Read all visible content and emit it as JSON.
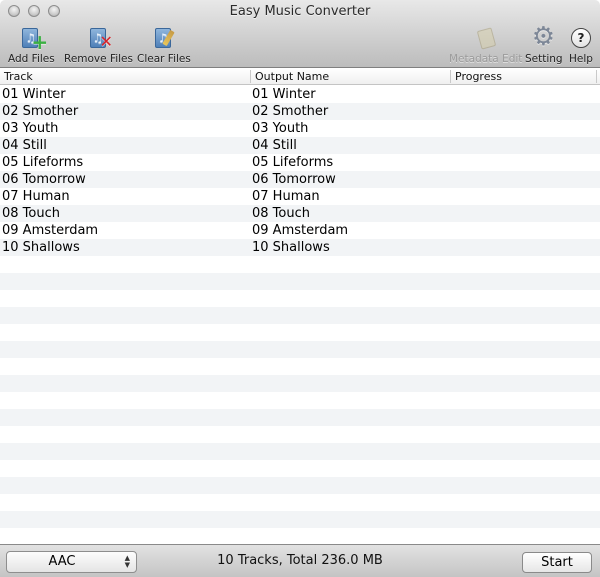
{
  "window": {
    "title": "Easy Music Converter"
  },
  "toolbar": {
    "add_files": "Add Files",
    "remove_files": "Remove Files",
    "clear_files": "Clear Files",
    "metadata_edit": "Metadata Edit",
    "setting": "Setting",
    "help": "Help"
  },
  "table": {
    "columns": [
      "Track",
      "Output Name",
      "Progress"
    ],
    "rows": [
      {
        "track": "01 Winter",
        "output": "01 Winter",
        "progress": ""
      },
      {
        "track": "02 Smother",
        "output": "02 Smother",
        "progress": ""
      },
      {
        "track": "03 Youth",
        "output": "03 Youth",
        "progress": ""
      },
      {
        "track": "04 Still",
        "output": "04 Still",
        "progress": ""
      },
      {
        "track": "05 Lifeforms",
        "output": "05 Lifeforms",
        "progress": ""
      },
      {
        "track": "06 Tomorrow",
        "output": "06 Tomorrow",
        "progress": ""
      },
      {
        "track": "07 Human",
        "output": "07 Human",
        "progress": ""
      },
      {
        "track": "08 Touch",
        "output": "08 Touch",
        "progress": ""
      },
      {
        "track": "09 Amsterdam",
        "output": "09 Amsterdam",
        "progress": ""
      },
      {
        "track": "10 Shallows",
        "output": "10 Shallows",
        "progress": ""
      }
    ]
  },
  "footer": {
    "format": "AAC",
    "status": "10 Tracks, Total 236.0 MB",
    "start_label": "Start"
  }
}
